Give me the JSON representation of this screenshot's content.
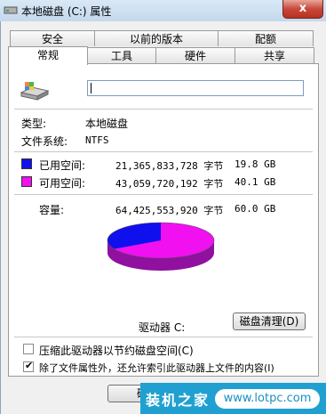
{
  "window": {
    "title": "本地磁盘 (C:) 属性",
    "close_label": "x"
  },
  "tabs_row1": [
    "安全",
    "以前的版本",
    "配额"
  ],
  "tabs_row2": [
    "常规",
    "工具",
    "硬件",
    "共享"
  ],
  "drive": {
    "name_value": "",
    "type_label": "类型:",
    "type_value": "本地磁盘",
    "fs_label": "文件系统:",
    "fs_value": "NTFS",
    "used_label": "已用空间:",
    "used_bytes": "21,365,833,728 字节",
    "used_size": "19.8 GB",
    "free_label": "可用空间:",
    "free_bytes": "43,059,720,192 字节",
    "free_size": "40.1 GB",
    "capacity_label": "容量:",
    "capacity_bytes": "64,425,553,920 字节",
    "capacity_size": "60.0 GB",
    "drive_label": "驱动器 C:",
    "cleanup_button": "磁盘清理(D)",
    "used_fraction": 0.33
  },
  "colors": {
    "used": "#1010ee",
    "free": "#f010f0"
  },
  "options": {
    "compress_label": "压缩此驱动器以节约磁盘空间(C)",
    "compress_checked": false,
    "index_label": "除了文件属性外，还允许索引此驱动器上文件的内容(I)",
    "index_checked": true
  },
  "footer": {
    "ok_button": "确"
  },
  "watermark": {
    "brand": "装机之家",
    "url": "www.lotpc.com"
  }
}
